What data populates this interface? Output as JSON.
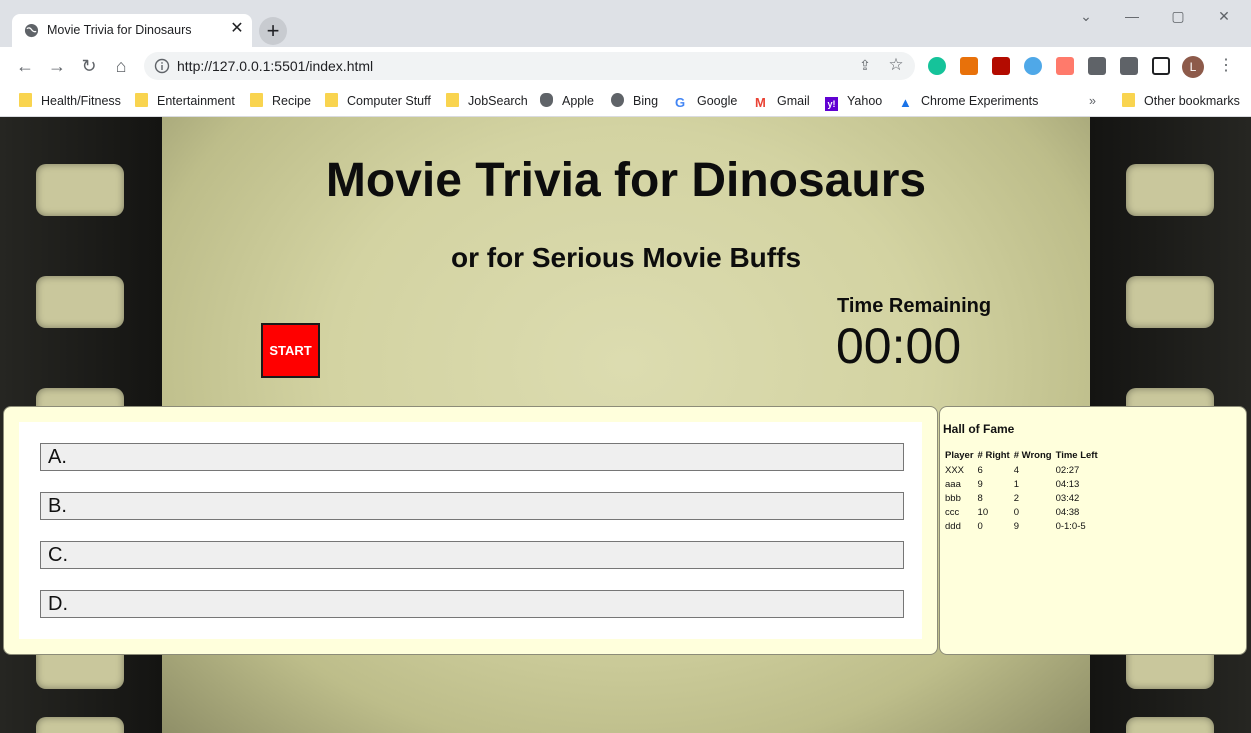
{
  "browser": {
    "tab_title": "Movie Trivia for Dinosaurs",
    "tab_close": "✕",
    "new_tab": "+",
    "url": "http://127.0.0.1:5501/index.html",
    "profile_initial": "L",
    "bookmarks": [
      "Health/Fitness",
      "Entertainment",
      "Recipe",
      "Computer Stuff",
      "JobSearch",
      "Apple",
      "Bing",
      "Google",
      "Gmail",
      "Yahoo",
      "Chrome Experiments"
    ],
    "more_bookmarks": "»",
    "other_bookmarks": "Other bookmarks"
  },
  "page": {
    "title": "Movie Trivia for Dinosaurs",
    "subtitle": "or for Serious Movie Buffs",
    "start_label": "START",
    "time_label": "Time Remaining",
    "time_value": "00:00",
    "answers": [
      "A.",
      "B.",
      "C.",
      "D."
    ],
    "hall_of_fame": {
      "title": "Hall of Fame",
      "headers": [
        "Player",
        "# Right",
        "# Wrong",
        "Time Left"
      ],
      "rows": [
        [
          "XXX",
          "6",
          "4",
          "02:27"
        ],
        [
          "aaa",
          "9",
          "1",
          "04:13"
        ],
        [
          "bbb",
          "8",
          "2",
          "03:42"
        ],
        [
          "ccc",
          "10",
          "0",
          "04:38"
        ],
        [
          "ddd",
          "0",
          "9",
          "0-1:0-5"
        ]
      ]
    }
  },
  "colors": {
    "start_button": "#ff0000",
    "panel_background": "#ffffdc",
    "film_frame": "#d3d3a2"
  }
}
